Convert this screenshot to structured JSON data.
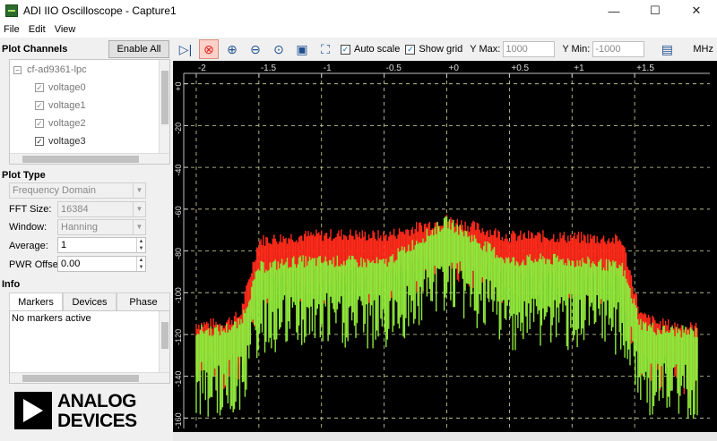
{
  "window": {
    "title": "ADI IIO Oscilloscope - Capture1",
    "minimize": "—",
    "maximize": "☐",
    "close": "✕"
  },
  "menu": [
    "File",
    "Edit",
    "View"
  ],
  "plot_channels": {
    "title": "Plot Channels",
    "enable_all": "Enable All",
    "device": "cf-ad9361-lpc",
    "channels": [
      {
        "name": "voltage0",
        "checked": true
      },
      {
        "name": "voltage1",
        "checked": true
      },
      {
        "name": "voltage2",
        "checked": true
      },
      {
        "name": "voltage3",
        "checked": true
      }
    ]
  },
  "plot_type": {
    "title": "Plot Type",
    "mode": "Frequency Domain",
    "fft_size_label": "FFT Size:",
    "fft_size": "16384",
    "window_label": "Window:",
    "window": "Hanning",
    "average_label": "Average:",
    "average": "1",
    "pwr_offset_label": "PWR Offset:",
    "pwr_offset": "0.00"
  },
  "info": {
    "title": "Info",
    "tabs": [
      "Markers",
      "Devices",
      "Phase"
    ],
    "active_tab": "Markers",
    "markers_text": "No markers active"
  },
  "logo": {
    "line1": "ANALOG",
    "line2": "DEVICES"
  },
  "toolbar": {
    "auto_scale": "Auto scale",
    "auto_scale_checked": true,
    "show_grid": "Show grid",
    "show_grid_checked": true,
    "ymax_label": "Y Max:",
    "ymax": "1000",
    "ymin_label": "Y Min:",
    "ymin": "-1000",
    "unit": "MHz"
  },
  "chart_data": {
    "type": "line",
    "xlabel": "MHz",
    "xlim": [
      -2.1,
      2.1
    ],
    "x_ticks": [
      -2,
      -1.5,
      -1,
      -0.5,
      0,
      0.5,
      1,
      1.5
    ],
    "x_tick_labels": [
      "-2",
      "-1.5",
      "-1",
      "-0.5",
      "+0",
      "+0.5",
      "+1",
      "+1.5"
    ],
    "ylim": [
      -165,
      5
    ],
    "y_ticks": [
      0,
      -20,
      -40,
      -60,
      -80,
      -100,
      -120,
      -140,
      -160
    ],
    "y_tick_labels": [
      "+0",
      "-20",
      "-40",
      "-60",
      "-80",
      "-100",
      "-120",
      "-140",
      "-160"
    ],
    "grid": true,
    "series": [
      {
        "color": "#ff2a1a",
        "x": [
          -2.0,
          -1.8,
          -1.65,
          -1.5,
          -1.2,
          -0.8,
          -0.5,
          0.0,
          0.5,
          0.8,
          1.2,
          1.4,
          1.55,
          1.7,
          2.0
        ],
        "y": [
          -122,
          -122,
          -118,
          -82,
          -80,
          -79,
          -80,
          -72,
          -80,
          -80,
          -81,
          -82,
          -118,
          -122,
          -124
        ]
      },
      {
        "color": "#8ee63a",
        "x": [
          -2.0,
          -1.8,
          -1.65,
          -1.5,
          -1.2,
          -0.8,
          -0.5,
          0.0,
          0.5,
          0.8,
          1.2,
          1.4,
          1.55,
          1.7,
          2.0
        ],
        "y": [
          -125,
          -125,
          -122,
          -95,
          -92,
          -92,
          -93,
          -73,
          -92,
          -91,
          -93,
          -95,
          -122,
          -125,
          -126
        ]
      }
    ]
  }
}
